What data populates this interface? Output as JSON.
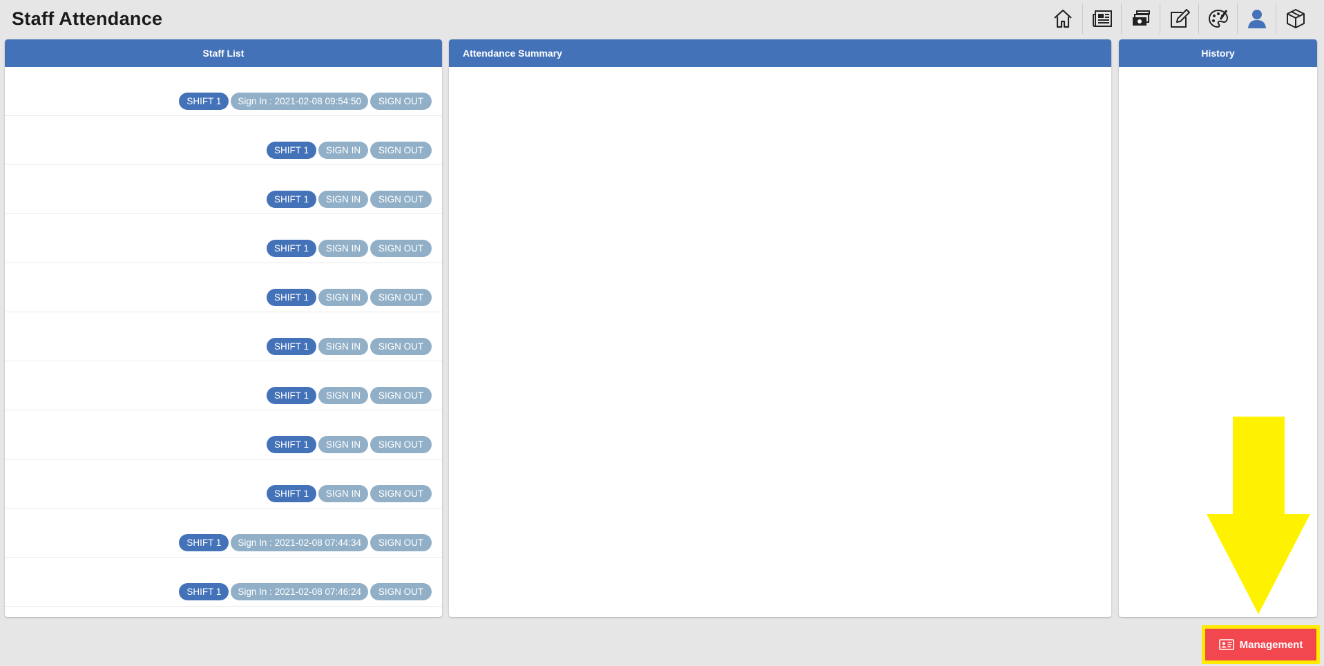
{
  "page": {
    "title": "Staff Attendance"
  },
  "toolbar": {
    "icons": [
      "home-icon",
      "newspaper-icon",
      "cash-register-icon",
      "edit-icon",
      "palette-icon",
      "user-icon",
      "box-icon"
    ]
  },
  "staff_list": {
    "title": "Staff List",
    "rows": [
      {
        "shift": "SHIFT 1",
        "sign_in": "Sign In : 2021-02-08 09:54:50",
        "sign_out": "SIGN OUT"
      },
      {
        "shift": "SHIFT 1",
        "sign_in": "SIGN IN",
        "sign_out": "SIGN OUT"
      },
      {
        "shift": "SHIFT 1",
        "sign_in": "SIGN IN",
        "sign_out": "SIGN OUT"
      },
      {
        "shift": "SHIFT 1",
        "sign_in": "SIGN IN",
        "sign_out": "SIGN OUT"
      },
      {
        "shift": "SHIFT 1",
        "sign_in": "SIGN IN",
        "sign_out": "SIGN OUT"
      },
      {
        "shift": "SHIFT 1",
        "sign_in": "SIGN IN",
        "sign_out": "SIGN OUT"
      },
      {
        "shift": "SHIFT 1",
        "sign_in": "SIGN IN",
        "sign_out": "SIGN OUT"
      },
      {
        "shift": "SHIFT 1",
        "sign_in": "SIGN IN",
        "sign_out": "SIGN OUT"
      },
      {
        "shift": "SHIFT 1",
        "sign_in": "SIGN IN",
        "sign_out": "SIGN OUT"
      },
      {
        "shift": "SHIFT 1",
        "sign_in": "Sign In : 2021-02-08 07:44:34",
        "sign_out": "SIGN OUT"
      },
      {
        "shift": "SHIFT 1",
        "sign_in": "Sign In : 2021-02-08 07:46:24",
        "sign_out": "SIGN OUT"
      }
    ]
  },
  "summary": {
    "title": "Attendance Summary"
  },
  "history": {
    "title": "History"
  },
  "management": {
    "label": "Management",
    "icon": "id-card-icon"
  },
  "colors": {
    "header": "#4472b8",
    "shift_pill": "#4472b8",
    "action_pill": "#91b0c8",
    "management_button": "#f2474f",
    "highlight": "#ffea00"
  }
}
